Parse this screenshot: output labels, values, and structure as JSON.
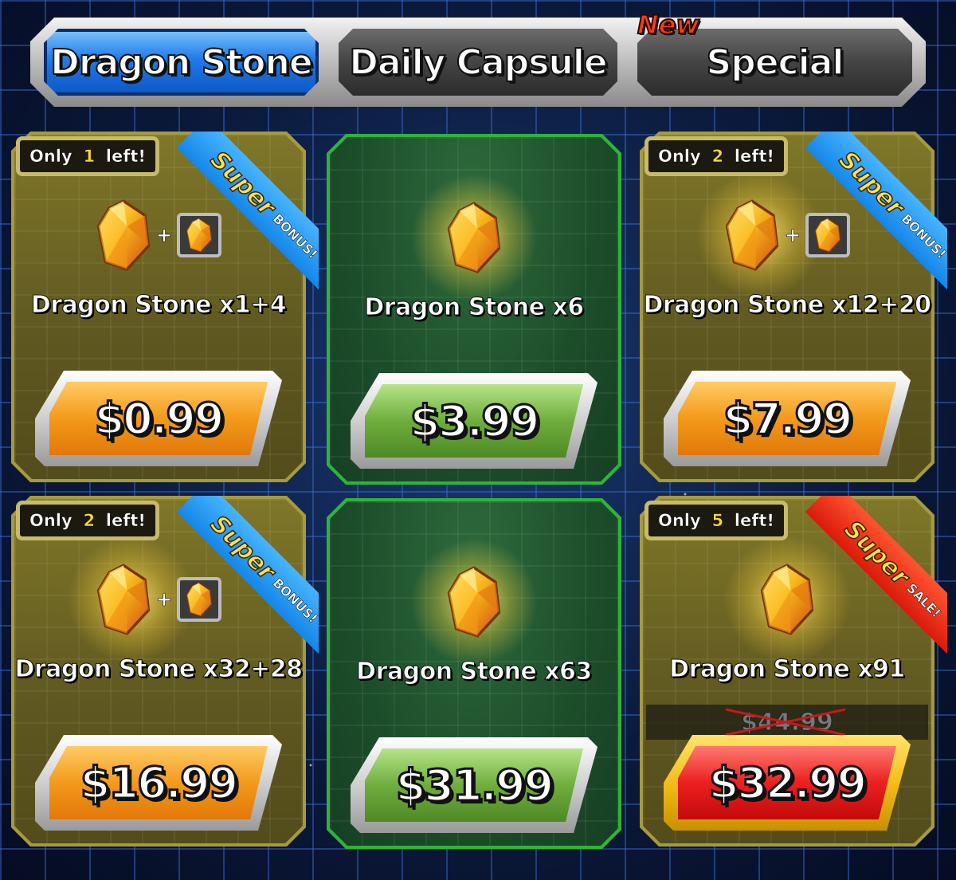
{
  "tabs": [
    {
      "label": "Dragon Stone",
      "active": true
    },
    {
      "label": "Daily Capsule",
      "active": false
    },
    {
      "label": "Special",
      "active": false,
      "badge": "New"
    }
  ],
  "colors": {
    "tab_active": "#1f7be8",
    "card_bonus": "#7f7728",
    "card_plain": "#1c4d2a",
    "price_orange": "#f39a1b",
    "price_green": "#6fae3d",
    "price_sale": "#ec1f1f"
  },
  "products": [
    {
      "name": "Dragon Stone x1+4",
      "price": "$0.99",
      "stock": {
        "prefix": "Only",
        "count": "1",
        "suffix": "left!"
      },
      "ribbon": {
        "big": "Super",
        "small": "BONUS!"
      },
      "icon": "dragon-stone-icon",
      "bonus_icon": "dragon-stone-bonus-icon",
      "plus": "+"
    },
    {
      "name": "Dragon Stone x6",
      "price": "$3.99",
      "icon": "dragon-stone-icon"
    },
    {
      "name": "Dragon Stone x12+20",
      "price": "$7.99",
      "stock": {
        "prefix": "Only",
        "count": "2",
        "suffix": "left!"
      },
      "ribbon": {
        "big": "Super",
        "small": "BONUS!"
      },
      "icon": "dragon-stone-icon",
      "bonus_icon": "dragon-stone-bonus-icon",
      "plus": "+"
    },
    {
      "name": "Dragon Stone x32+28",
      "price": "$16.99",
      "stock": {
        "prefix": "Only",
        "count": "2",
        "suffix": "left!"
      },
      "ribbon": {
        "big": "Super",
        "small": "BONUS!"
      },
      "icon": "dragon-stone-icon",
      "bonus_icon": "dragon-stone-bonus-icon",
      "plus": "+"
    },
    {
      "name": "Dragon Stone x63",
      "price": "$31.99",
      "icon": "dragon-stone-icon"
    },
    {
      "name": "Dragon Stone x91",
      "price": "$32.99",
      "original_price": "$44.99",
      "stock": {
        "prefix": "Only",
        "count": "5",
        "suffix": "left!"
      },
      "ribbon": {
        "big": "Super",
        "small": "SALE!"
      },
      "icon": "dragon-stone-icon"
    }
  ]
}
